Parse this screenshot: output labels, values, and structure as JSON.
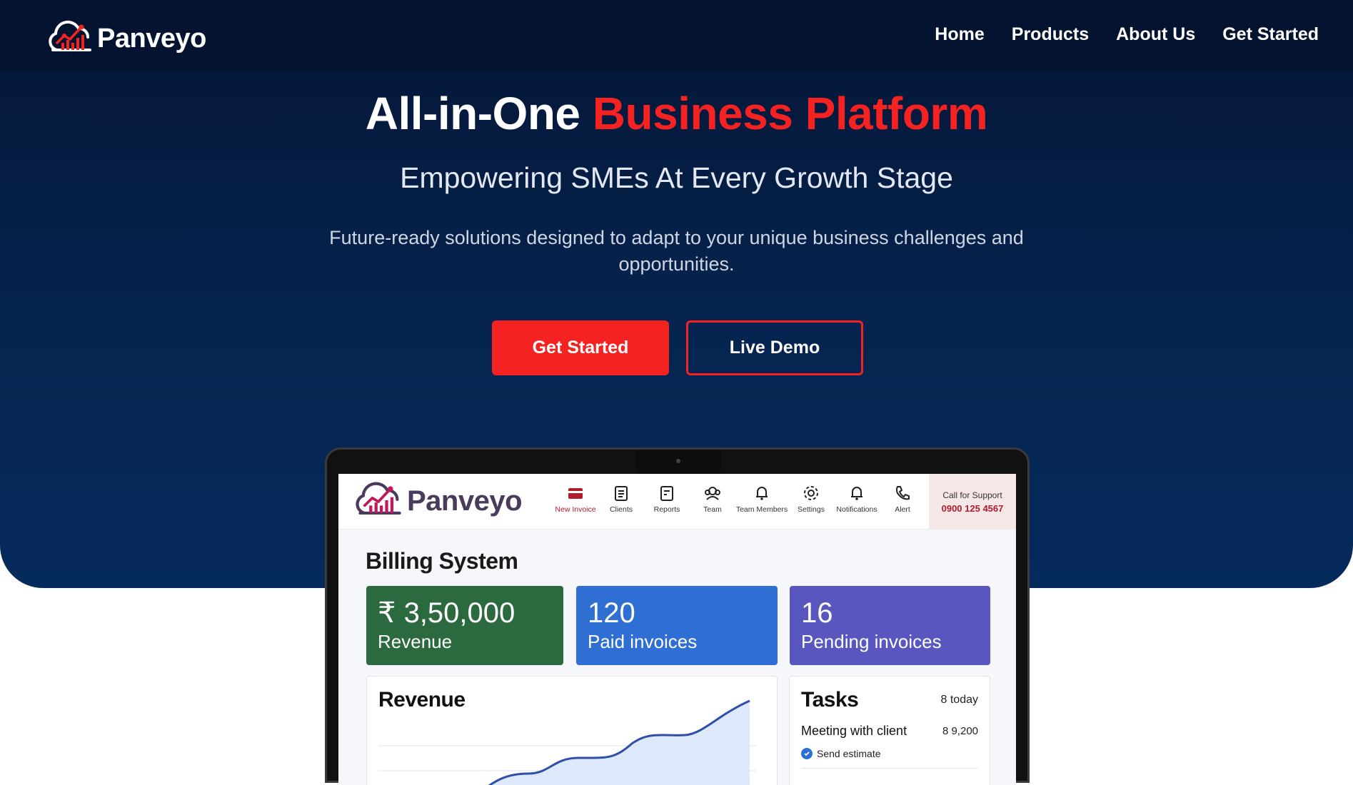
{
  "brand": {
    "name": "Panveyo",
    "accent": "#f52222",
    "navy": "#041430"
  },
  "nav": {
    "links": [
      "Home",
      "Products",
      "About Us",
      "Get Started"
    ]
  },
  "hero": {
    "title_main": "All-in-One",
    "title_accent": "Business Platform",
    "subtitle": "Empowering SMEs At Every Growth Stage",
    "description": "Future-ready solutions designed to adapt to your unique business challenges and opportunities.",
    "primary_button": "Get Started",
    "secondary_button": "Live Demo"
  },
  "app": {
    "logo_text": "Panveyo",
    "nav_items": [
      {
        "label": "New Invoice",
        "icon": "card-icon"
      },
      {
        "label": "Clients",
        "icon": "document-icon"
      },
      {
        "label": "Reports",
        "icon": "report-icon"
      },
      {
        "label": "Team",
        "icon": "team-icon"
      },
      {
        "label": "Team Members",
        "icon": "bell-icon"
      },
      {
        "label": "Settings",
        "icon": "gear-icon"
      },
      {
        "label": "Notifications",
        "icon": "bell-icon"
      },
      {
        "label": "Alert",
        "icon": "phone-icon"
      }
    ],
    "support": {
      "label": "Call for Support",
      "phone": "0900 125 4567"
    },
    "page_heading": "Billing System",
    "stats": [
      {
        "value": "₹ 3,50,000",
        "label": "Revenue",
        "color": "#2b6a3f"
      },
      {
        "value": "120",
        "label": "Paid invoices",
        "color": "#2f6fd3"
      },
      {
        "value": "16",
        "label": "Pending invoices",
        "color": "#5a56c0"
      }
    ],
    "revenue_card": {
      "title": "Revenue"
    },
    "tasks_card": {
      "title": "Tasks",
      "count": "8 today",
      "item_name": "Meeting with client",
      "item_amount": "8 9,200",
      "check_label": "Send estimate"
    }
  }
}
